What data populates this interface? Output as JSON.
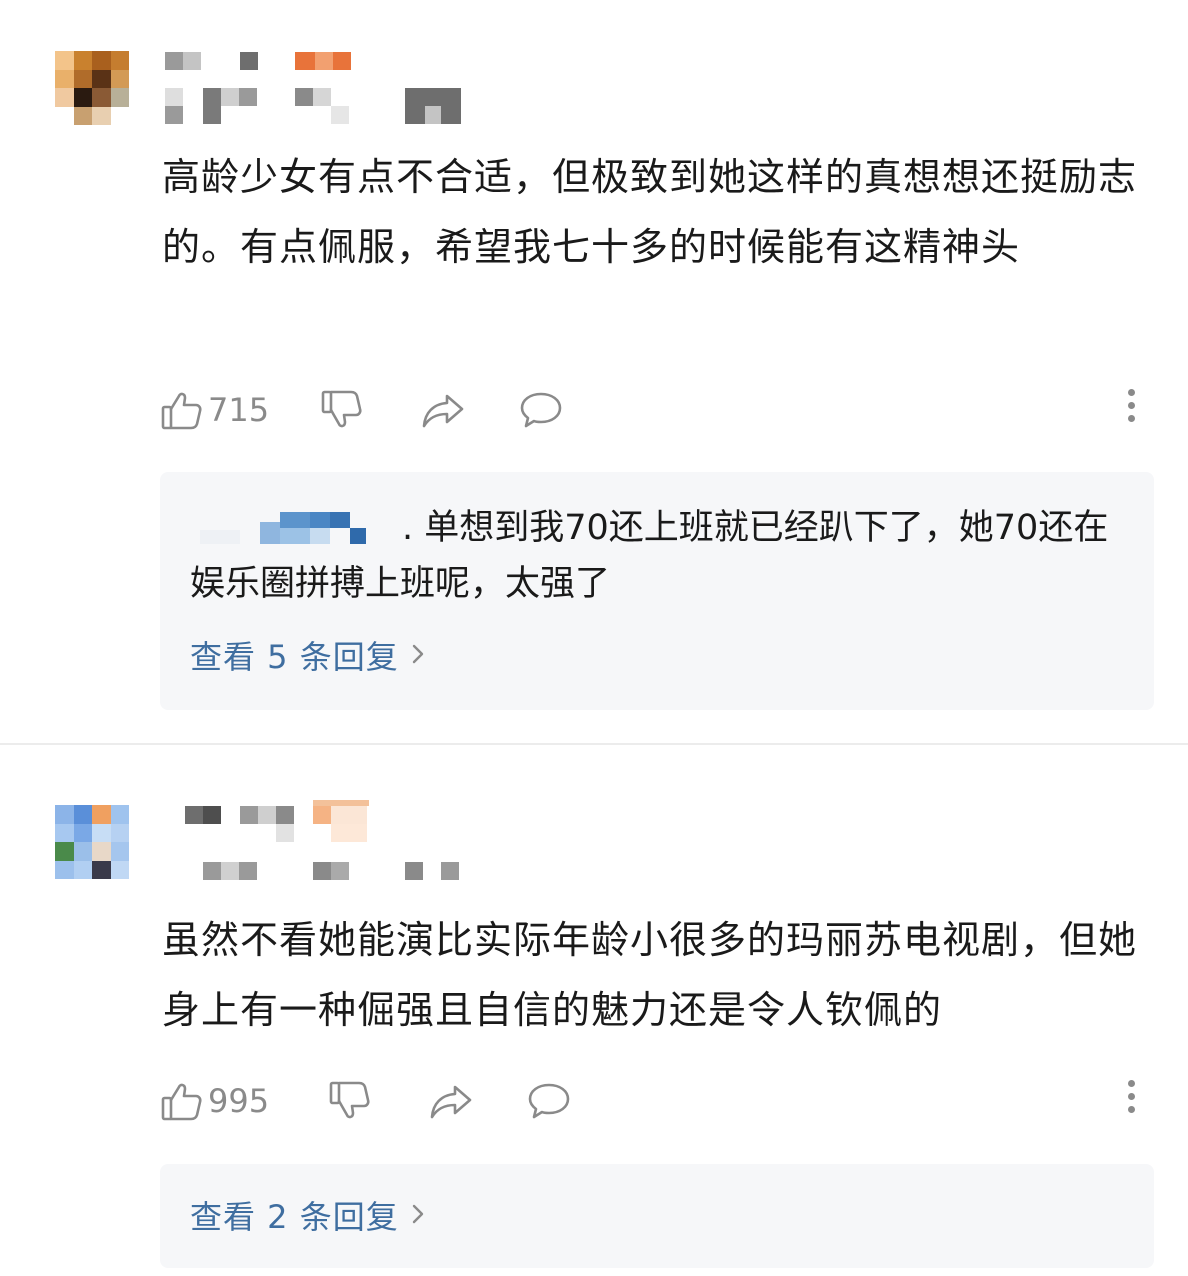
{
  "comments": [
    {
      "text": "高龄少女有点不合适，但极致到她这样的真想想还挺励志的。有点佩服，希望我七十多的时候能有这精神头",
      "likes": "715",
      "reply_preview": {
        "text": ". 单想到我70还上班就已经趴下了，她70还在娱乐圈拼搏上班呢，太强了"
      },
      "view_replies": "查看 5 条回复"
    },
    {
      "text": "虽然不看她能演比实际年龄小很多的玛丽苏电视剧，但她身上有一种倔强且自信的魅力还是令人钦佩的",
      "likes": "995",
      "view_replies": "查看 2 条回复"
    }
  ],
  "icons": {
    "like": "thumbs-up-icon",
    "dislike": "thumbs-down-icon",
    "share": "share-arrow-icon",
    "reply": "comment-bubble-icon",
    "more": "more-vertical-icon",
    "chevron": "chevron-right-icon"
  },
  "colors": {
    "link": "#3f6ea0",
    "icon": "#8a8a8a",
    "reply_bg": "#f6f7f9"
  }
}
